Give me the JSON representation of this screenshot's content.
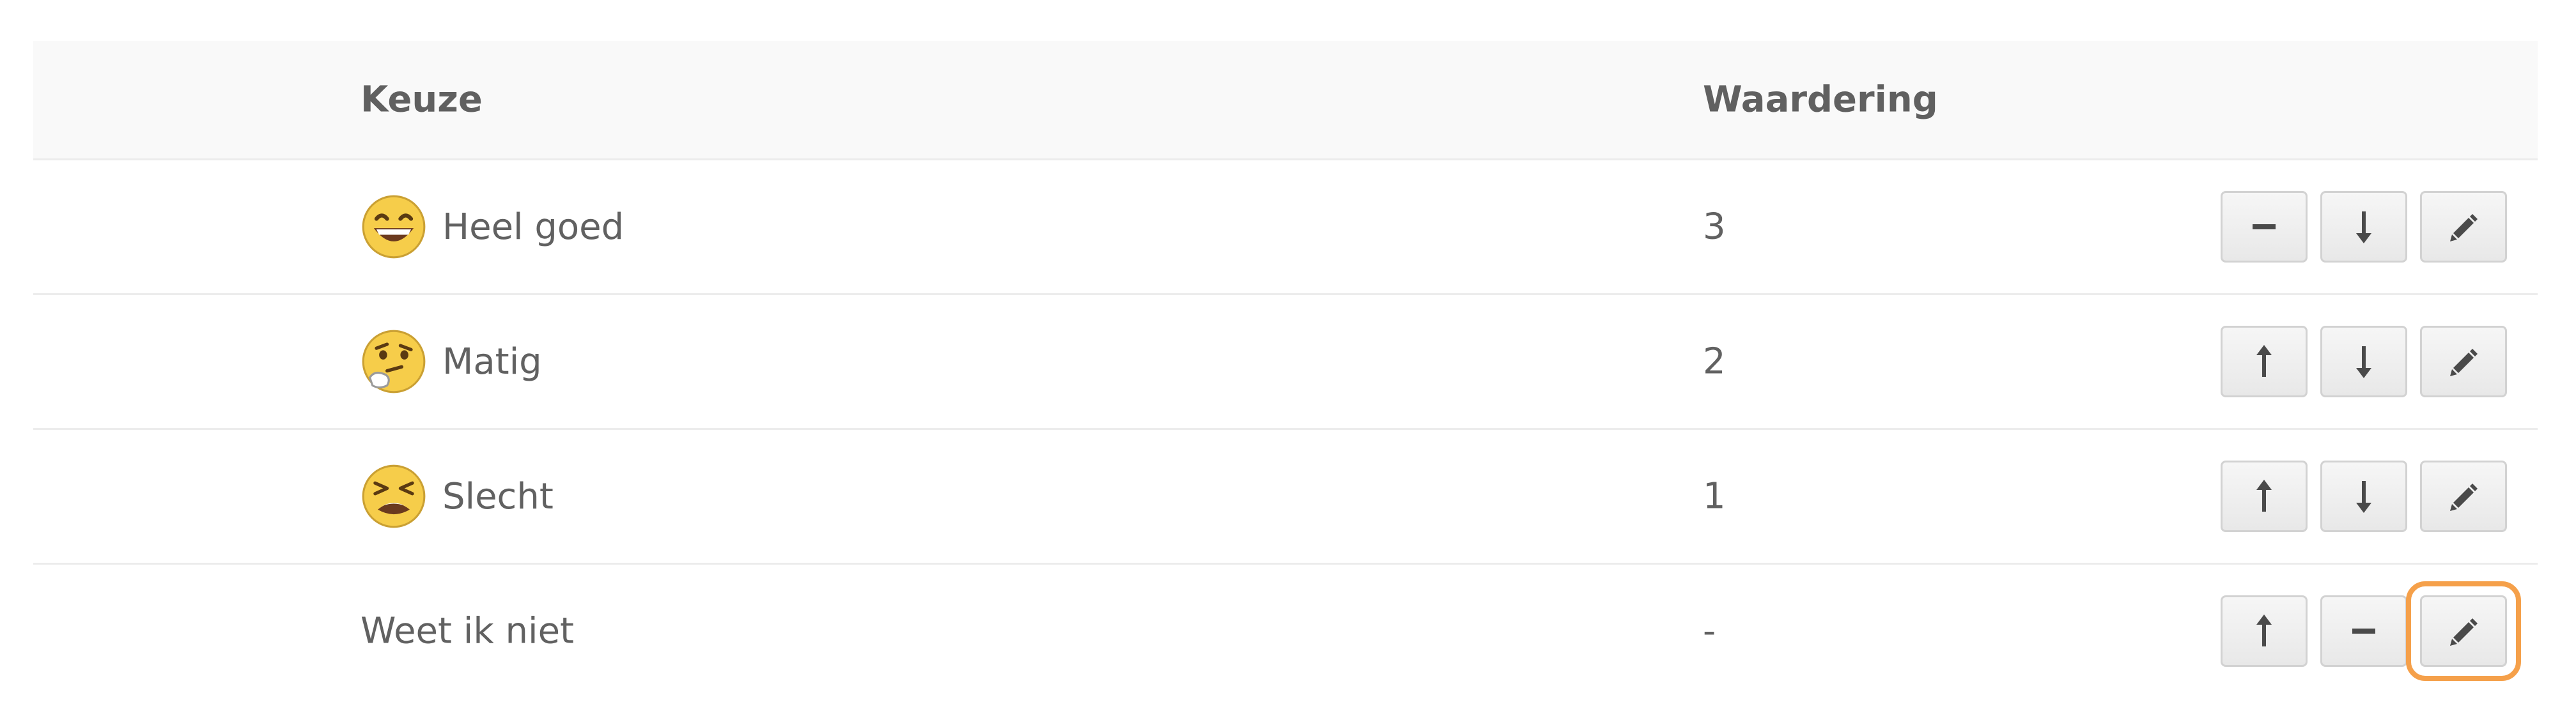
{
  "table": {
    "headers": {
      "keuze": "Keuze",
      "waardering": "Waardering"
    },
    "rows": [
      {
        "label": "Heel goed",
        "value": "3",
        "emoji": "grinning-face-icon",
        "actions": [
          "minus-icon",
          "arrow-down-icon",
          "pencil-icon"
        ]
      },
      {
        "label": "Matig",
        "value": "2",
        "emoji": "thinking-face-icon",
        "actions": [
          "arrow-up-icon",
          "arrow-down-icon",
          "pencil-icon"
        ]
      },
      {
        "label": "Slecht",
        "value": "1",
        "emoji": "tired-face-icon",
        "actions": [
          "arrow-up-icon",
          "arrow-down-icon",
          "pencil-icon"
        ]
      },
      {
        "label": "Weet ik niet",
        "value": "-",
        "emoji": "",
        "actions": [
          "arrow-up-icon",
          "minus-icon",
          "pencil-icon"
        ]
      }
    ]
  },
  "colors": {
    "focus_outline": "#f5a04a",
    "header_bg": "#f9f9f9",
    "emoji_yellow": "#f6cd4a"
  }
}
